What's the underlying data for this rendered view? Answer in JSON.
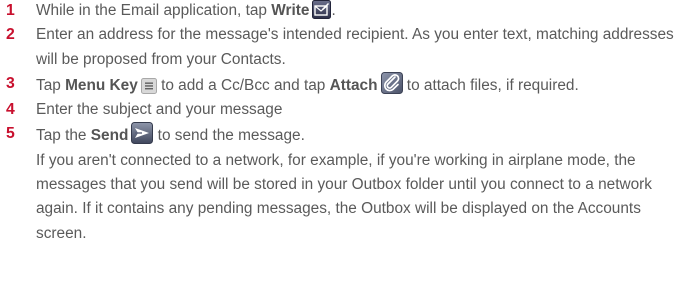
{
  "steps": [
    {
      "number": "1",
      "pre": "While in the Email application, tap ",
      "bold": "Write",
      "post": "."
    },
    {
      "number": "2",
      "text": "Enter an address for the message's intended recipient. As you enter text, matching addresses will be proposed from your Contacts."
    },
    {
      "number": "3",
      "pre": "Tap ",
      "bold1": "Menu Key",
      "mid": " to add a Cc/Bcc and tap ",
      "bold2": "Attach",
      "post": " to attach files, if required."
    },
    {
      "number": "4",
      "text": "Enter the subject and your message"
    },
    {
      "number": "5",
      "pre": "Tap the ",
      "bold": "Send",
      "post": " to send the message.",
      "note": "If you aren't connected to a network, for example, if you're working in airplane mode, the messages that you send will be stored in your Outbox folder until you connect to a network again. If it contains any pending messages, the Outbox will be displayed on the Accounts screen."
    }
  ],
  "icons": {
    "write": "compose-icon",
    "menu_key": "menu-key-icon",
    "attach": "paperclip-icon",
    "send": "send-icon"
  }
}
